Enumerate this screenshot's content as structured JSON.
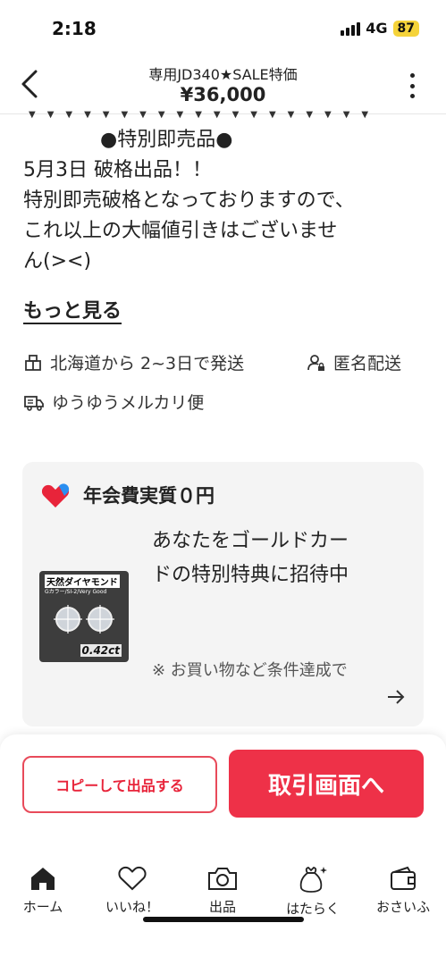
{
  "status_bar": {
    "time": "2:18",
    "network": "4G",
    "battery": "87"
  },
  "header": {
    "title": "専用JD340★SALE特価",
    "price": "¥36,000"
  },
  "description": {
    "line1": "●特別即売品●",
    "line2": "5月3日 破格出品！！",
    "line3": "特別即売破格となっておりますので、",
    "line4": "これ以上の大幅値引きはございませ",
    "line5": "ん(><)",
    "see_more": "もっと見る"
  },
  "shipping": {
    "ship_from": "北海道から 2~3日で発送",
    "anonymous": "匿名配送",
    "method": "ゆうゆうメルカリ便"
  },
  "promo": {
    "title": "年会費実質０円",
    "image_label": "天然ダイヤモンド",
    "image_sub": "Gカラー/SI-2/Very Good",
    "image_carat": "0.42ct",
    "text": "あなたをゴールドカードの特別特典に招待中",
    "note": "※ お買い物など条件達成で"
  },
  "actions": {
    "copy_label": "コピーして出品する",
    "trade_label": "取引画面へ"
  },
  "tabs": [
    {
      "label": "ホーム",
      "icon": "home-icon"
    },
    {
      "label": "いいね！",
      "icon": "heart-icon"
    },
    {
      "label": "出品",
      "icon": "camera-icon"
    },
    {
      "label": "はたらく",
      "icon": "sparkle-bag-icon"
    },
    {
      "label": "おさいふ",
      "icon": "wallet-icon"
    }
  ],
  "colors": {
    "accent": "#ee3148",
    "card_bg": "#f4f4f4",
    "battery": "#f5d33a"
  }
}
